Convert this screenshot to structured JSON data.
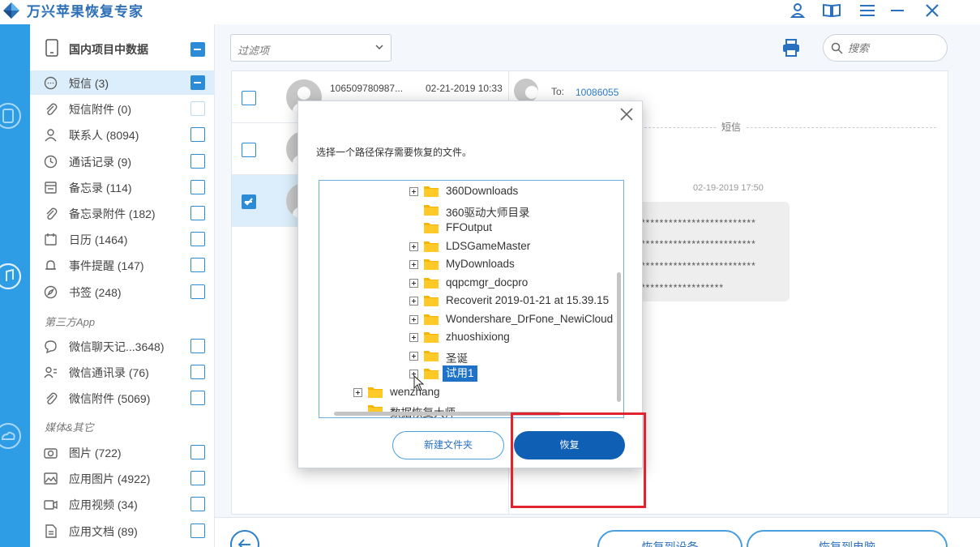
{
  "app": {
    "title": "万兴苹果恢复专家",
    "brand_color": "#2d6fb6",
    "controls": [
      "user-icon",
      "book-icon",
      "menu-icon",
      "minimize-icon",
      "close-icon"
    ]
  },
  "sidebar": {
    "header": "国内项目中数据",
    "items": [
      {
        "label": "短信 (3)",
        "icon": "message-icon",
        "state": "indeterminate",
        "active": true
      },
      {
        "label": "短信附件 (0)",
        "icon": "paperclip-icon",
        "state": "disabled"
      },
      {
        "label": "联系人 (8094)",
        "icon": "person-icon",
        "state": "unchecked"
      },
      {
        "label": "通话记录 (9)",
        "icon": "clock-icon",
        "state": "unchecked"
      },
      {
        "label": "备忘录 (114)",
        "icon": "note-icon",
        "state": "unchecked"
      },
      {
        "label": "备忘录附件 (182)",
        "icon": "paperclip-icon",
        "state": "unchecked"
      },
      {
        "label": "日历 (1464)",
        "icon": "calendar-icon",
        "state": "unchecked"
      },
      {
        "label": "事件提醒 (147)",
        "icon": "bell-icon",
        "state": "unchecked"
      },
      {
        "label": "书签 (248)",
        "icon": "compass-icon",
        "state": "unchecked"
      }
    ],
    "section_third_party": "第三方App",
    "third_party_items": [
      {
        "label": "微信聊天记...3648)",
        "icon": "chat-icon",
        "state": "unchecked"
      },
      {
        "label": "微信通讯录 (76)",
        "icon": "contacts-icon",
        "state": "unchecked"
      },
      {
        "label": "微信附件 (5069)",
        "icon": "paperclip-icon",
        "state": "unchecked"
      }
    ],
    "section_media": "媒体&其它",
    "media_items": [
      {
        "label": "图片 (722)",
        "icon": "camera-icon",
        "state": "unchecked"
      },
      {
        "label": "应用图片 (4922)",
        "icon": "image-icon",
        "state": "unchecked"
      },
      {
        "label": "应用视频 (34)",
        "icon": "video-icon",
        "state": "unchecked"
      },
      {
        "label": "应用文档 (89)",
        "icon": "document-icon",
        "state": "unchecked"
      }
    ]
  },
  "toolbar": {
    "filter_label": "过滤项",
    "search_placeholder": "搜索"
  },
  "messages": [
    {
      "number": "106509780987...",
      "date": "02-21-2019 10:33",
      "checked": false
    },
    {
      "number": "",
      "date": "",
      "checked": false
    },
    {
      "number": "",
      "date": "",
      "checked": true
    }
  ],
  "detail": {
    "to_label": "To:",
    "to_number": "10086055",
    "tag": "短信",
    "time": "02-19-2019 17:50",
    "lines": [
      "*************************",
      "*************************",
      "*************************",
      "******************"
    ]
  },
  "dialog": {
    "prompt": "选择一个路径保存需要恢复的文件。",
    "tree": [
      {
        "name": "360Downloads",
        "expandable": true,
        "level": 2
      },
      {
        "name": "360驱动大师目录",
        "expandable": false,
        "level": 2
      },
      {
        "name": "FFOutput",
        "expandable": false,
        "level": 2
      },
      {
        "name": "LDSGameMaster",
        "expandable": true,
        "level": 2
      },
      {
        "name": "MyDownloads",
        "expandable": true,
        "level": 2
      },
      {
        "name": "qqpcmgr_docpro",
        "expandable": true,
        "level": 2
      },
      {
        "name": "Recoverit 2019-01-21 at 15.39.15",
        "expandable": true,
        "level": 2
      },
      {
        "name": "Wondershare_DrFone_NewiCloud",
        "expandable": true,
        "level": 2
      },
      {
        "name": "zhuoshixiong",
        "expandable": true,
        "level": 2
      },
      {
        "name": "圣诞",
        "expandable": true,
        "level": 2
      },
      {
        "name": "试用1",
        "expandable": true,
        "level": 2,
        "selected": true
      },
      {
        "name": "wenzhang",
        "expandable": true,
        "level": 1
      },
      {
        "name": "数据恢复大师",
        "expandable": false,
        "level": 1
      }
    ],
    "new_folder_label": "新建文件夹",
    "restore_label": "恢复"
  },
  "bottom": {
    "restore_device_label": "恢复到设备",
    "restore_pc_label": "恢复到电脑"
  },
  "colors": {
    "accent": "#2c8bd6",
    "rail": "#2f9ce6",
    "primary_button": "#0f5fb5",
    "highlight": "#e0232f"
  }
}
